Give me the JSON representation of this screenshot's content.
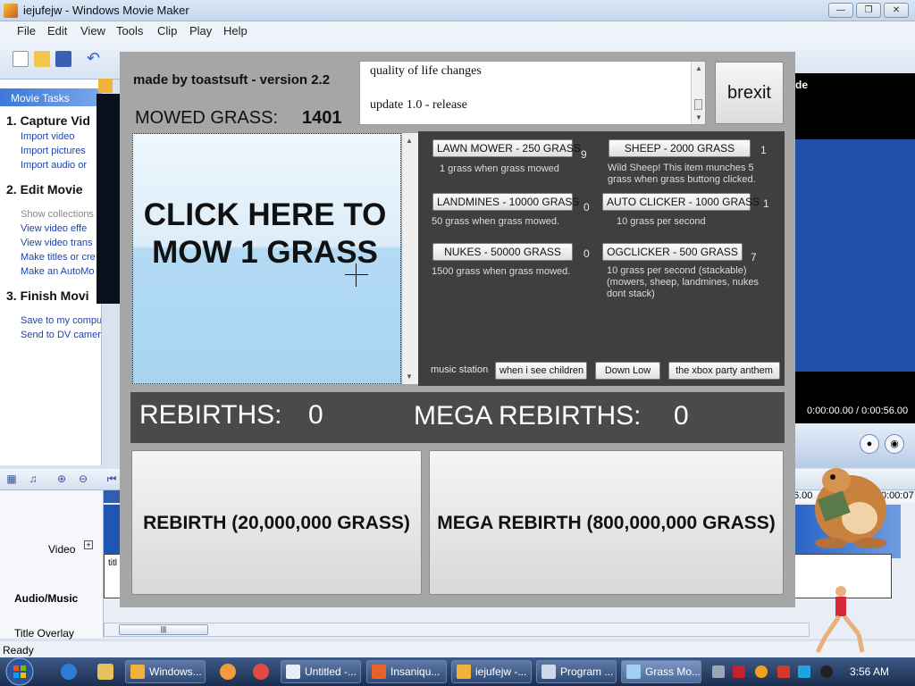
{
  "wmm": {
    "title": "iejufejw - Windows Movie Maker",
    "menu": [
      "File",
      "Edit",
      "View",
      "Tools",
      "Clip",
      "Play",
      "Help"
    ],
    "taskpane_header": "Movie Tasks",
    "sections": [
      {
        "heading": "1. Capture Vid",
        "links": [
          "Import video",
          "Import pictures",
          "Import audio or"
        ]
      },
      {
        "heading": "2. Edit Movie",
        "links": [
          "Show collections",
          "View video effe",
          "View video trans",
          "Make titles or cre",
          "Make an AutoMo"
        ]
      },
      {
        "heading": "3. Finish Movi",
        "links": [
          "Save to my computer",
          "Send to DV camera"
        ]
      }
    ],
    "right_panel_label": "de",
    "time_display": "0:00:00.00 / 0:00:56.00",
    "tracks": {
      "video": "Video",
      "audio": "Audio/Music",
      "title": "Title Overlay"
    },
    "track_video_expand": "+",
    "audio_clip_label": "titl",
    "ruler": [
      "6.00",
      "0:00:07"
    ],
    "status": "Ready"
  },
  "game": {
    "credit": "made by toastsuft - version 2.2",
    "mowed_label": "MOWED GRASS:",
    "mowed_value": "1401",
    "changelog": [
      "quality of life changes",
      "update 1.0 - release"
    ],
    "brexit_label": "brexit",
    "mow_label": "CLICK HERE TO MOW 1 GRASS",
    "shop": [
      {
        "label": "LAWN MOWER - 250 GRASS",
        "count": "9",
        "desc": [
          "1 grass when grass mowed"
        ]
      },
      {
        "label": "SHEEP - 2000 GRASS",
        "count": "1",
        "desc": [
          "Wild Sheep! This item munches 5",
          "grass when grass buttong clicked."
        ]
      },
      {
        "label": "LANDMINES - 10000 GRASS",
        "count": "0",
        "desc": [
          "50 grass when grass mowed."
        ]
      },
      {
        "label": "AUTO CLICKER - 1000 GRASS",
        "count": "1",
        "desc": [
          "10 grass per second"
        ]
      },
      {
        "label": "NUKES - 50000 GRASS",
        "count": "0",
        "desc": [
          "1500 grass when grass mowed."
        ]
      },
      {
        "label": "OGCLICKER - 500 GRASS",
        "count": "7",
        "desc": [
          "10 grass per second (stackable)",
          "(mowers, sheep, landmines, nukes",
          "dont stack)"
        ]
      }
    ],
    "music_label": "music station",
    "music_buttons": [
      "when i see children",
      "Down Low",
      "the xbox party anthem"
    ],
    "rebirths_label": "REBIRTHS:",
    "rebirths_value": "0",
    "mega_rebirths_label": "MEGA REBIRTHS:",
    "mega_rebirths_value": "0",
    "rebirth_button": "REBIRTH (20,000,000 GRASS)",
    "mega_rebirth_button": "MEGA REBIRTH (800,000,000 GRASS)"
  },
  "taskbar": {
    "buttons": [
      "Windows...",
      "Untitled -...",
      "Insaniqu...",
      "iejufejw -...",
      "Program ...",
      "Grass Mo..."
    ],
    "clock": "3:56 AM"
  },
  "colors": {
    "game_bg": "#a6a6a6",
    "shop_bg": "#3f3f3f",
    "rebirth_bar": "#4a4a4a",
    "mow_button_light": "#eef7fd",
    "mow_button_dark": "#a8d4f1"
  }
}
